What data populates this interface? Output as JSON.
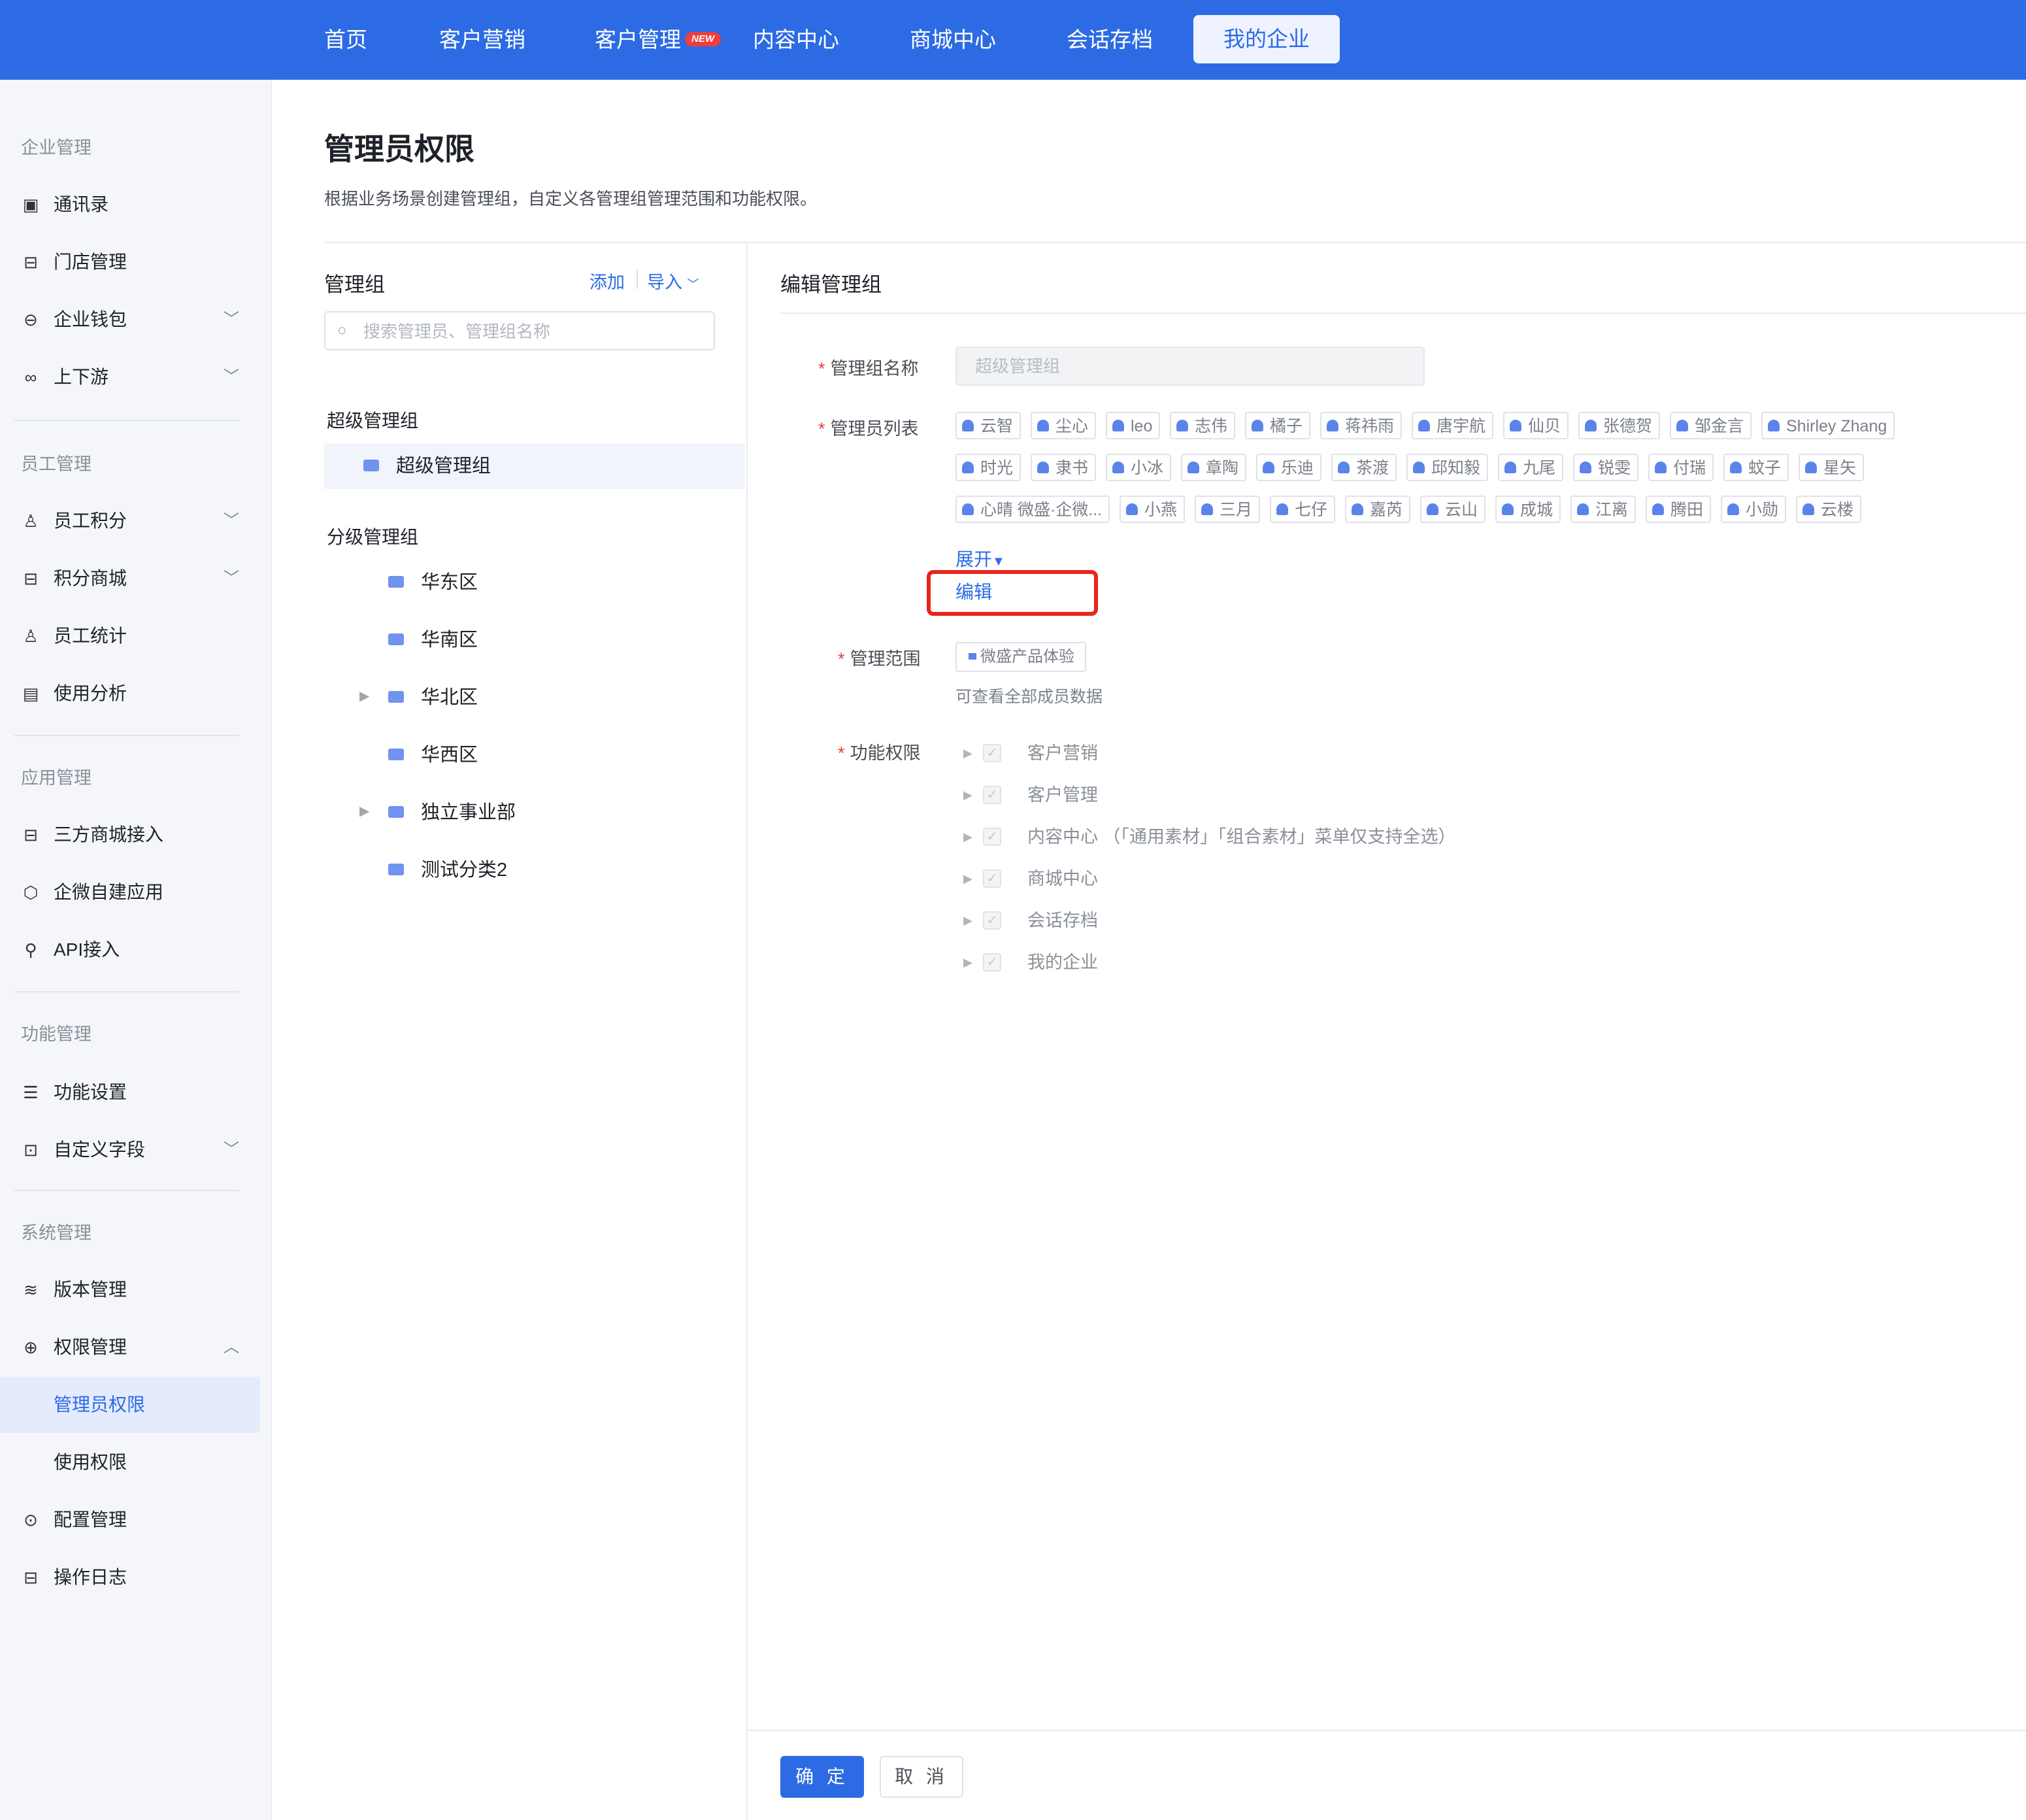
{
  "topnav": {
    "items": [
      {
        "label": "首页"
      },
      {
        "label": "客户营销"
      },
      {
        "label": "客户管理",
        "badge": "NEW"
      },
      {
        "label": "内容中心"
      },
      {
        "label": "商城中心"
      },
      {
        "label": "会话存档"
      },
      {
        "label": "我的企业",
        "active": true
      }
    ]
  },
  "sidebar": {
    "categories": [
      "企业管理",
      "员工管理",
      "应用管理",
      "功能管理",
      "系统管理"
    ],
    "items": [
      {
        "label": "通讯录",
        "icon": "contacts-icon"
      },
      {
        "label": "门店管理",
        "icon": "store-icon"
      },
      {
        "label": "企业钱包",
        "icon": "wallet-icon",
        "expandable": true
      },
      {
        "label": "上下游",
        "icon": "link-icon",
        "expandable": true
      },
      {
        "label": "员工积分",
        "icon": "user-icon",
        "expandable": true
      },
      {
        "label": "积分商城",
        "icon": "shop-icon",
        "expandable": true
      },
      {
        "label": "员工统计",
        "icon": "user-stats-icon"
      },
      {
        "label": "使用分析",
        "icon": "report-icon"
      },
      {
        "label": "三方商城接入",
        "icon": "shop-connect-icon"
      },
      {
        "label": "企微自建应用",
        "icon": "app-icon"
      },
      {
        "label": "API接入",
        "icon": "api-icon"
      },
      {
        "label": "功能设置",
        "icon": "sliders-icon"
      },
      {
        "label": "自定义字段",
        "icon": "field-icon",
        "expandable": true
      },
      {
        "label": "版本管理",
        "icon": "layers-icon"
      },
      {
        "label": "权限管理",
        "icon": "lock-icon",
        "expanded": true
      },
      {
        "label": "管理员权限",
        "active": true
      },
      {
        "label": "使用权限"
      },
      {
        "label": "配置管理",
        "icon": "config-icon"
      },
      {
        "label": "操作日志",
        "icon": "log-icon"
      }
    ]
  },
  "page": {
    "title": "管理员权限",
    "description": "根据业务场景创建管理组，自定义各管理组管理范围和功能权限。"
  },
  "groups_panel": {
    "title": "管理组",
    "add_label": "添加",
    "import_label": "导入",
    "search_placeholder": "搜索管理员、管理组名称",
    "super_group_label": "超级管理组",
    "super_groups": [
      "超级管理组"
    ],
    "sub_group_label": "分级管理组",
    "sub_groups": [
      {
        "name": "华东区"
      },
      {
        "name": "华南区"
      },
      {
        "name": "华北区",
        "has_children": true
      },
      {
        "name": "华西区"
      },
      {
        "name": "独立事业部",
        "has_children": true
      },
      {
        "name": "测试分类2"
      }
    ]
  },
  "edit_panel": {
    "title": "编辑管理组",
    "name_label": "管理组名称",
    "name_value": "超级管理组",
    "admins_label": "管理员列表",
    "admins": [
      [
        "云智",
        "尘心",
        "leo",
        "志伟",
        "橘子",
        "蒋祎雨",
        "唐宇航",
        "仙贝",
        "张德贺",
        "邹金言",
        "Shirley Zhang"
      ],
      [
        "时光",
        "隶书",
        "小冰",
        "章陶",
        "乐迪",
        "茶渡",
        "邱知毅",
        "九尾",
        "锐雯",
        "付瑞",
        "蚊子",
        "星矢"
      ],
      [
        "心晴 微盛·企微...",
        "小燕",
        "三月",
        "七仔",
        "嘉芮",
        "云山",
        "成城",
        "江离",
        "腾田",
        "小勋",
        "云楼"
      ]
    ],
    "expand_label": "展开",
    "edit_label": "编辑",
    "scope_label": "管理范围",
    "scope_value": "微盛产品体验",
    "scope_hint": "可查看全部成员数据",
    "perm_label": "功能权限",
    "permissions": [
      "客户营销",
      "客户管理",
      "内容中心 （「通用素材」「组合素材」菜单仅支持全选）",
      "商城中心",
      "会话存档",
      "我的企业"
    ]
  },
  "footer": {
    "confirm_label": "确 定",
    "cancel_label": "取 消"
  },
  "colors": {
    "primary": "#2d6be4",
    "highlight_box": "#e8261e",
    "badge": "#f03d3d"
  }
}
